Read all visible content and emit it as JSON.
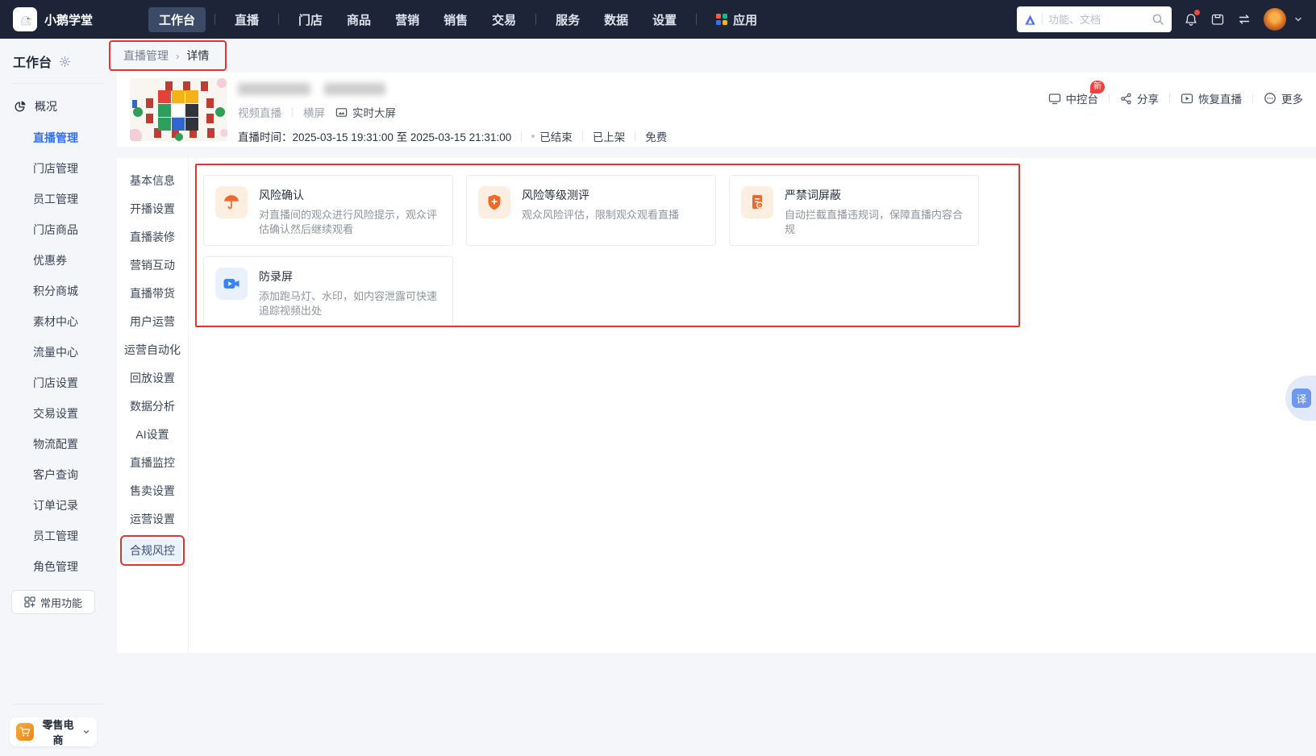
{
  "colors": {
    "navbar_bg": "#1d2438",
    "accent_blue": "#3370ff",
    "annotation_red": "#e5342f",
    "icon_orange": "#ee6a28",
    "icon_blue": "#3b82f4"
  },
  "navbar": {
    "brand": "小鹅学堂",
    "items": [
      {
        "label": "工作台",
        "active": true
      },
      {
        "label": "直播"
      },
      {
        "label": "门店"
      },
      {
        "label": "商品"
      },
      {
        "label": "营销"
      },
      {
        "label": "销售"
      },
      {
        "label": "交易"
      },
      {
        "label": "服务"
      },
      {
        "label": "数据"
      },
      {
        "label": "设置"
      }
    ],
    "apps_label": "应用",
    "search": {
      "placeholder": "功能、文档"
    }
  },
  "sidebar": {
    "title": "工作台",
    "overview": "概况",
    "items": [
      "直播管理",
      "门店管理",
      "员工管理",
      "门店商品",
      "优惠券",
      "积分商城",
      "素材中心",
      "流量中心",
      "门店设置",
      "交易设置",
      "物流配置",
      "客户查询",
      "订单记录",
      "员工管理",
      "角色管理"
    ],
    "active_item": "直播管理",
    "common_button": "常用功能",
    "store_switcher": "零售电商"
  },
  "breadcrumb": {
    "parent": "直播管理",
    "separator": "›",
    "current": "详情"
  },
  "header": {
    "type": "视频直播",
    "orientation": "横屏",
    "big_screen": "实时大屏",
    "time_label": "直播时间：",
    "time_value": "2025-03-15 19:31:00 至 2025-03-15 21:31:00",
    "status": [
      "已结束",
      "已上架",
      "免费"
    ],
    "actions": [
      {
        "label": "中控台",
        "badge": "新"
      },
      {
        "label": "分享"
      },
      {
        "label": "恢复直播"
      },
      {
        "label": "更多"
      }
    ]
  },
  "submenu": {
    "items": [
      "基本信息",
      "开播设置",
      "直播装修",
      "营销互动",
      "直播带货",
      "用户运营",
      "运营自动化",
      "回放设置",
      "数据分析",
      "AI设置",
      "直播监控",
      "售卖设置",
      "运营设置",
      "合规风控"
    ],
    "active_item": "合规风控"
  },
  "cards": [
    {
      "title": "风险确认",
      "desc": "对直播间的观众进行风险提示，观众评估确认然后继续观看",
      "icon": "umbrella-icon"
    },
    {
      "title": "风险等级测评",
      "desc": "观众风险评估，限制观众观看直播",
      "icon": "shield-plus-icon"
    },
    {
      "title": "严禁词屏蔽",
      "desc": "自动拦截直播违规词，保障直播内容合规",
      "icon": "banned-words-icon"
    },
    {
      "title": "防录屏",
      "desc": "添加跑马灯、水印，如内容泄露可快速追踪视频出处",
      "icon": "screen-record-icon"
    }
  ],
  "translate_button": "译"
}
